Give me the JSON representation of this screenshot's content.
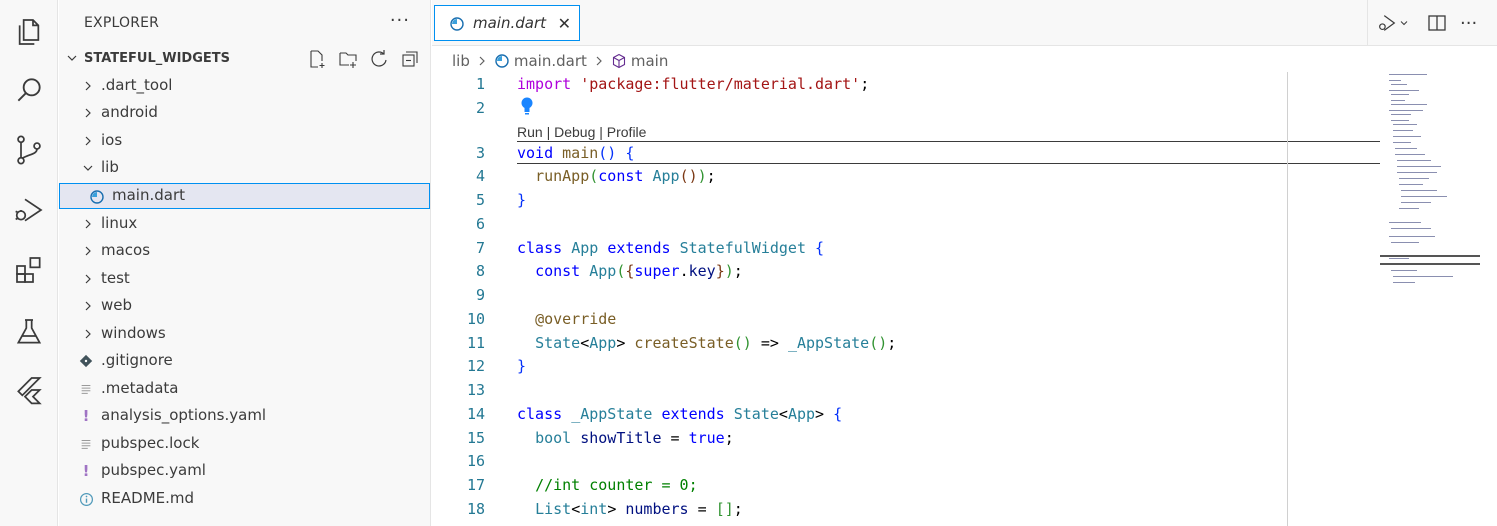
{
  "explorer": {
    "title": "EXPLORER",
    "more": "···",
    "section_name": "STATEFUL_WIDGETS",
    "items": [
      {
        "label": ".dart_tool",
        "type": "folder"
      },
      {
        "label": "android",
        "type": "folder"
      },
      {
        "label": "ios",
        "type": "folder"
      },
      {
        "label": "lib",
        "type": "folder-open"
      },
      {
        "label": "main.dart",
        "type": "dart-file"
      },
      {
        "label": "linux",
        "type": "folder"
      },
      {
        "label": "macos",
        "type": "folder"
      },
      {
        "label": "test",
        "type": "folder"
      },
      {
        "label": "web",
        "type": "folder"
      },
      {
        "label": "windows",
        "type": "folder"
      },
      {
        "label": ".gitignore",
        "type": "git-file"
      },
      {
        "label": ".metadata",
        "type": "text-file"
      },
      {
        "label": "analysis_options.yaml",
        "type": "yaml-file"
      },
      {
        "label": "pubspec.lock",
        "type": "text-file"
      },
      {
        "label": "pubspec.yaml",
        "type": "yaml-file"
      },
      {
        "label": "README.md",
        "type": "info-file"
      }
    ]
  },
  "tab": {
    "label": "main.dart",
    "close": "✕"
  },
  "breadcrumb": {
    "part1": "lib",
    "part2": "main.dart",
    "part3": "main"
  },
  "codelens": "Run | Debug | Profile",
  "line_numbers": [
    "1",
    "2",
    "3",
    "4",
    "5",
    "6",
    "7",
    "8",
    "9",
    "10",
    "11",
    "12",
    "13",
    "14",
    "15",
    "16",
    "17",
    "18"
  ],
  "colors": {
    "accent": "#0090f1",
    "line_number": "#237893",
    "keyword": "#0000ff"
  },
  "icons": [
    "explorer-icon",
    "search-icon",
    "source-control-icon",
    "run-debug-icon",
    "extensions-icon",
    "testing-icon",
    "flutter-icon"
  ]
}
